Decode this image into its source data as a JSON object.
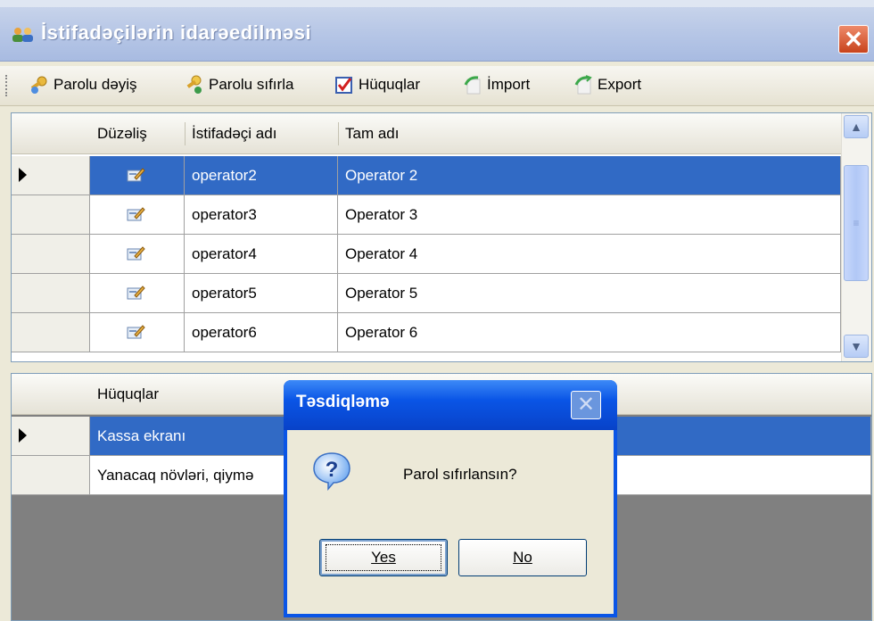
{
  "window": {
    "title": "İstifadəçilərin idarəedilməsi",
    "close_glyph": "✕"
  },
  "toolbar": {
    "buttons": [
      {
        "label": "Parolu dəyiş",
        "icon": "key-user-icon"
      },
      {
        "label": "Parolu sıfırla",
        "icon": "key-reset-icon"
      },
      {
        "label": "Hüquqlar",
        "icon": "checkbox-icon"
      },
      {
        "label": "İmport",
        "icon": "import-icon"
      },
      {
        "label": "Export",
        "icon": "export-icon"
      }
    ]
  },
  "users_grid": {
    "columns": [
      "Düzəliş",
      "İstifadəçi adı",
      "Tam adı"
    ],
    "rows": [
      {
        "username": "operator2",
        "fullname": "Operator 2",
        "selected": true
      },
      {
        "username": "operator3",
        "fullname": "Operator 3",
        "selected": false
      },
      {
        "username": "operator4",
        "fullname": "Operator 4",
        "selected": false
      },
      {
        "username": "operator5",
        "fullname": "Operator 5",
        "selected": false
      },
      {
        "username": "operator6",
        "fullname": "Operator 6",
        "selected": false
      }
    ],
    "scroll_up": "▲",
    "scroll_down": "▼",
    "thumb_grip": "≡"
  },
  "rights_grid": {
    "column": "Hüquqlar",
    "rows": [
      {
        "label": "Kassa ekranı",
        "selected": true
      },
      {
        "label": "Yanacaq növləri, qiymə",
        "selected": false
      }
    ]
  },
  "dialog": {
    "title": "Təsdiqləmə",
    "message": "Parol sıfırlansın?",
    "yes": "Yes",
    "no": "No",
    "close_glyph": "✕",
    "icon": "question-icon"
  },
  "colors": {
    "selection": "#316ac5",
    "titlebar": "#b6c6e6",
    "dialog_title": "#0a55e6"
  }
}
